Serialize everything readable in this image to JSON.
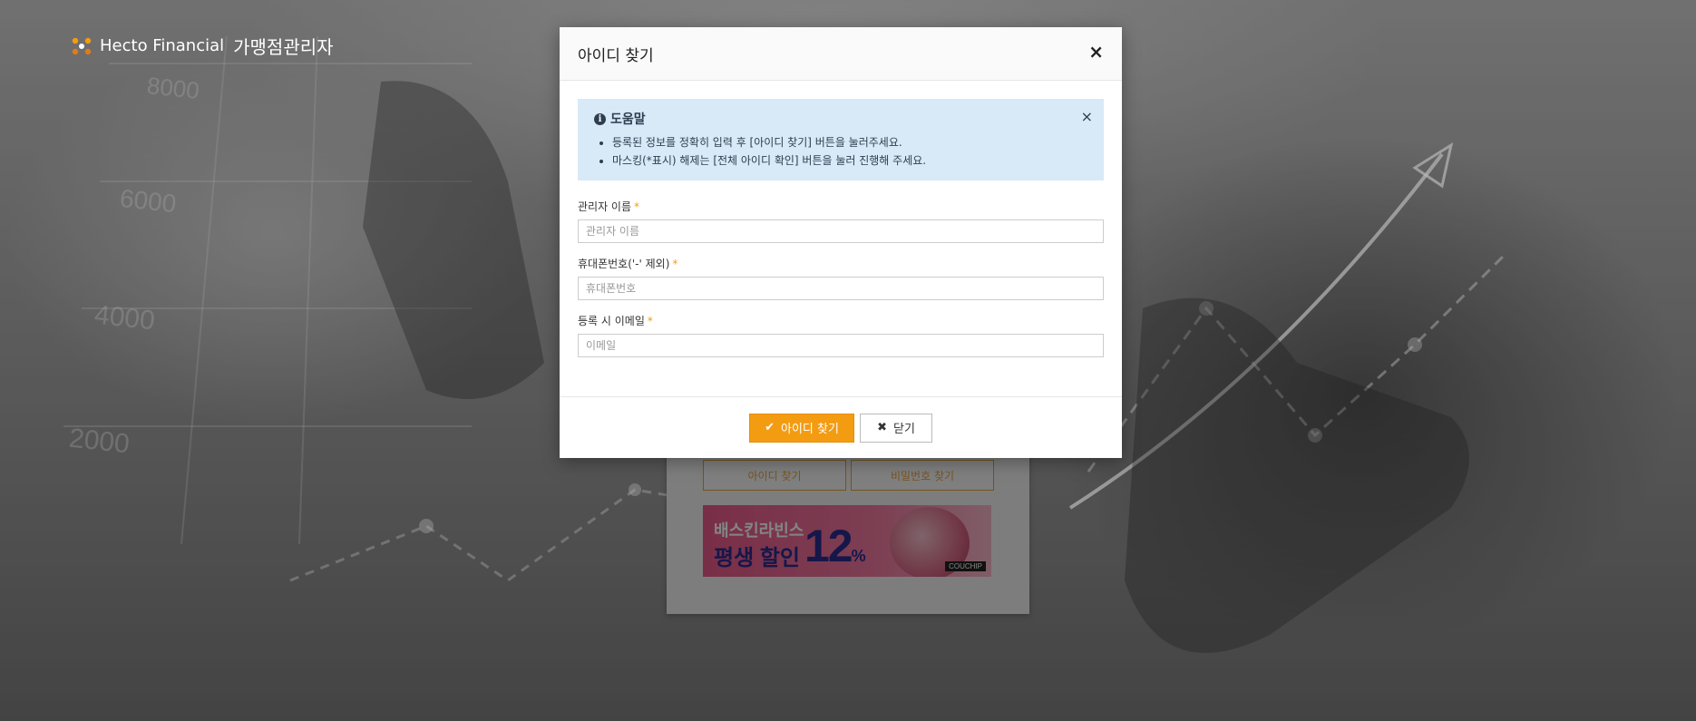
{
  "brand": {
    "name": "Hecto Financial",
    "subtitle": "가맹점관리자"
  },
  "background_card": {
    "find_id_label": "아이디 찾기",
    "find_password_label": "비밀번호 찾기",
    "banner": {
      "line1": "배스킨라빈스",
      "line2": "평생 할인",
      "discount": "12",
      "percent": "%",
      "tag": "COUCHIP"
    }
  },
  "chart_ticks": [
    "8000",
    "6000",
    "4000",
    "2000"
  ],
  "modal": {
    "title": "아이디 찾기",
    "close_icon": "close-icon",
    "help": {
      "title": "도움말",
      "items": [
        "등록된 정보를 정확히 입력 후 [아이디 찾기] 버튼을 눌러주세요.",
        "마스킹(*표시) 해제는 [전체 아이디 확인] 버튼을 눌러 진행해 주세요."
      ]
    },
    "fields": {
      "name": {
        "label": "관리자 이름",
        "required": "*",
        "placeholder": "관리자 이름",
        "value": ""
      },
      "phone": {
        "label": "휴대폰번호('-' 제외)",
        "required": "*",
        "placeholder": "휴대폰번호",
        "value": ""
      },
      "email": {
        "label": "등록 시 이메일",
        "required": "*",
        "placeholder": "이메일",
        "value": ""
      }
    },
    "buttons": {
      "submit": "아이디 찾기",
      "close": "닫기"
    }
  },
  "colors": {
    "accent": "#f39c12",
    "help_bg": "#d8e9f7",
    "help_text": "#2c3e50"
  }
}
